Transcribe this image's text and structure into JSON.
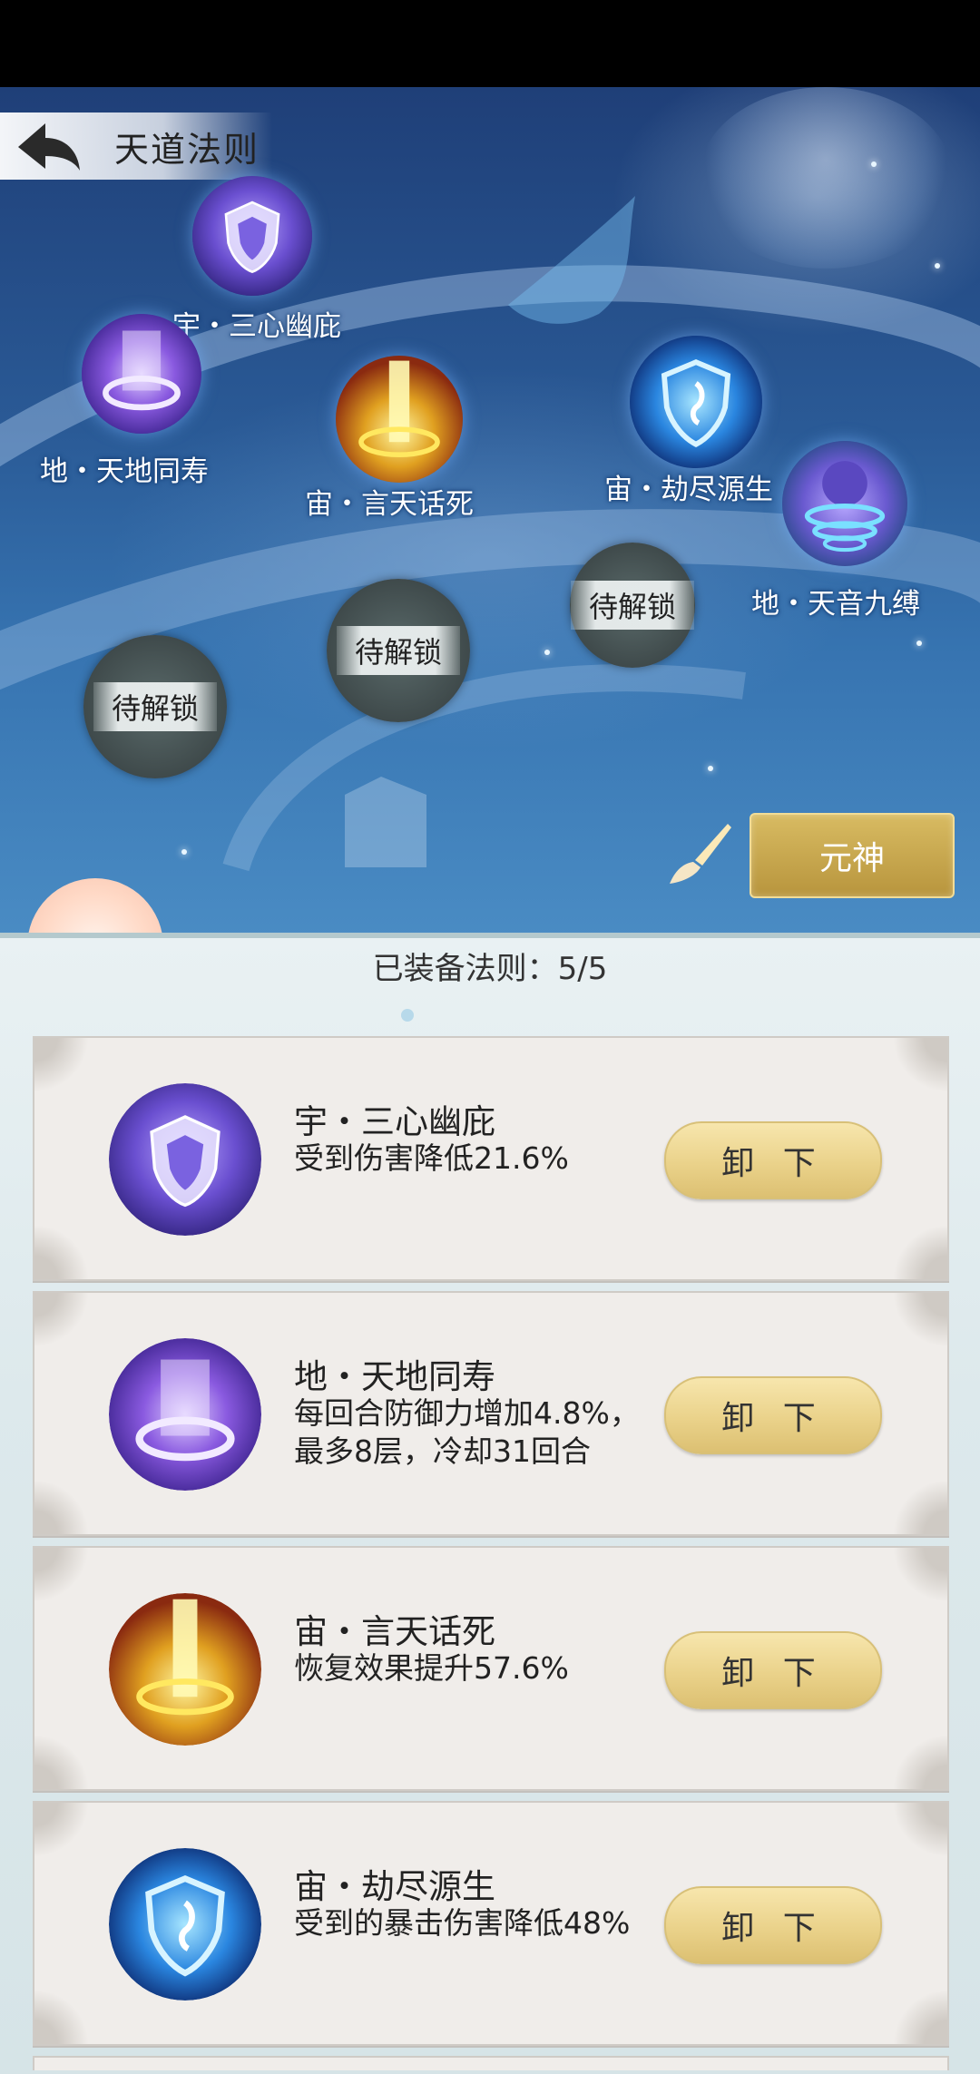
{
  "page_title": "天道法则",
  "nodes": [
    {
      "label": "宇・三心幽庇",
      "icon": "shield-rune-icon",
      "color": "#6a4fd0"
    },
    {
      "label": "地・天地同寿",
      "icon": "purple-vortex-icon",
      "color": "#8a5ae0"
    },
    {
      "label": "宙・言天话死",
      "icon": "golden-light-pillar-icon",
      "color": "#e0a020"
    },
    {
      "label": "宙・劫尽源生",
      "icon": "blue-shield-icon",
      "color": "#2a86e0"
    },
    {
      "label": "地・天音九缚",
      "icon": "purple-whirlwind-icon",
      "color": "#6a5ad0"
    }
  ],
  "locked_nodes": [
    "待解锁",
    "待解锁",
    "待解锁"
  ],
  "yuanshen_button": "元神",
  "equipped_header": "已装备法则：5/5",
  "equipped": [
    {
      "name": "宇・三心幽庇",
      "desc": "受到伤害降低21.6%",
      "button": "卸 下",
      "icon": "shield-rune-icon"
    },
    {
      "name": "地・天地同寿",
      "desc": "每回合防御力增加4.8%，最多8层，冷却31回合",
      "button": "卸 下",
      "icon": "purple-vortex-icon"
    },
    {
      "name": "宙・言天话死",
      "desc": "恢复效果提升57.6%",
      "button": "卸 下",
      "icon": "golden-light-pillar-icon"
    },
    {
      "name": "宙・劫尽源生",
      "desc": "受到的暴击伤害降低48%",
      "button": "卸 下",
      "icon": "blue-shield-icon"
    }
  ]
}
